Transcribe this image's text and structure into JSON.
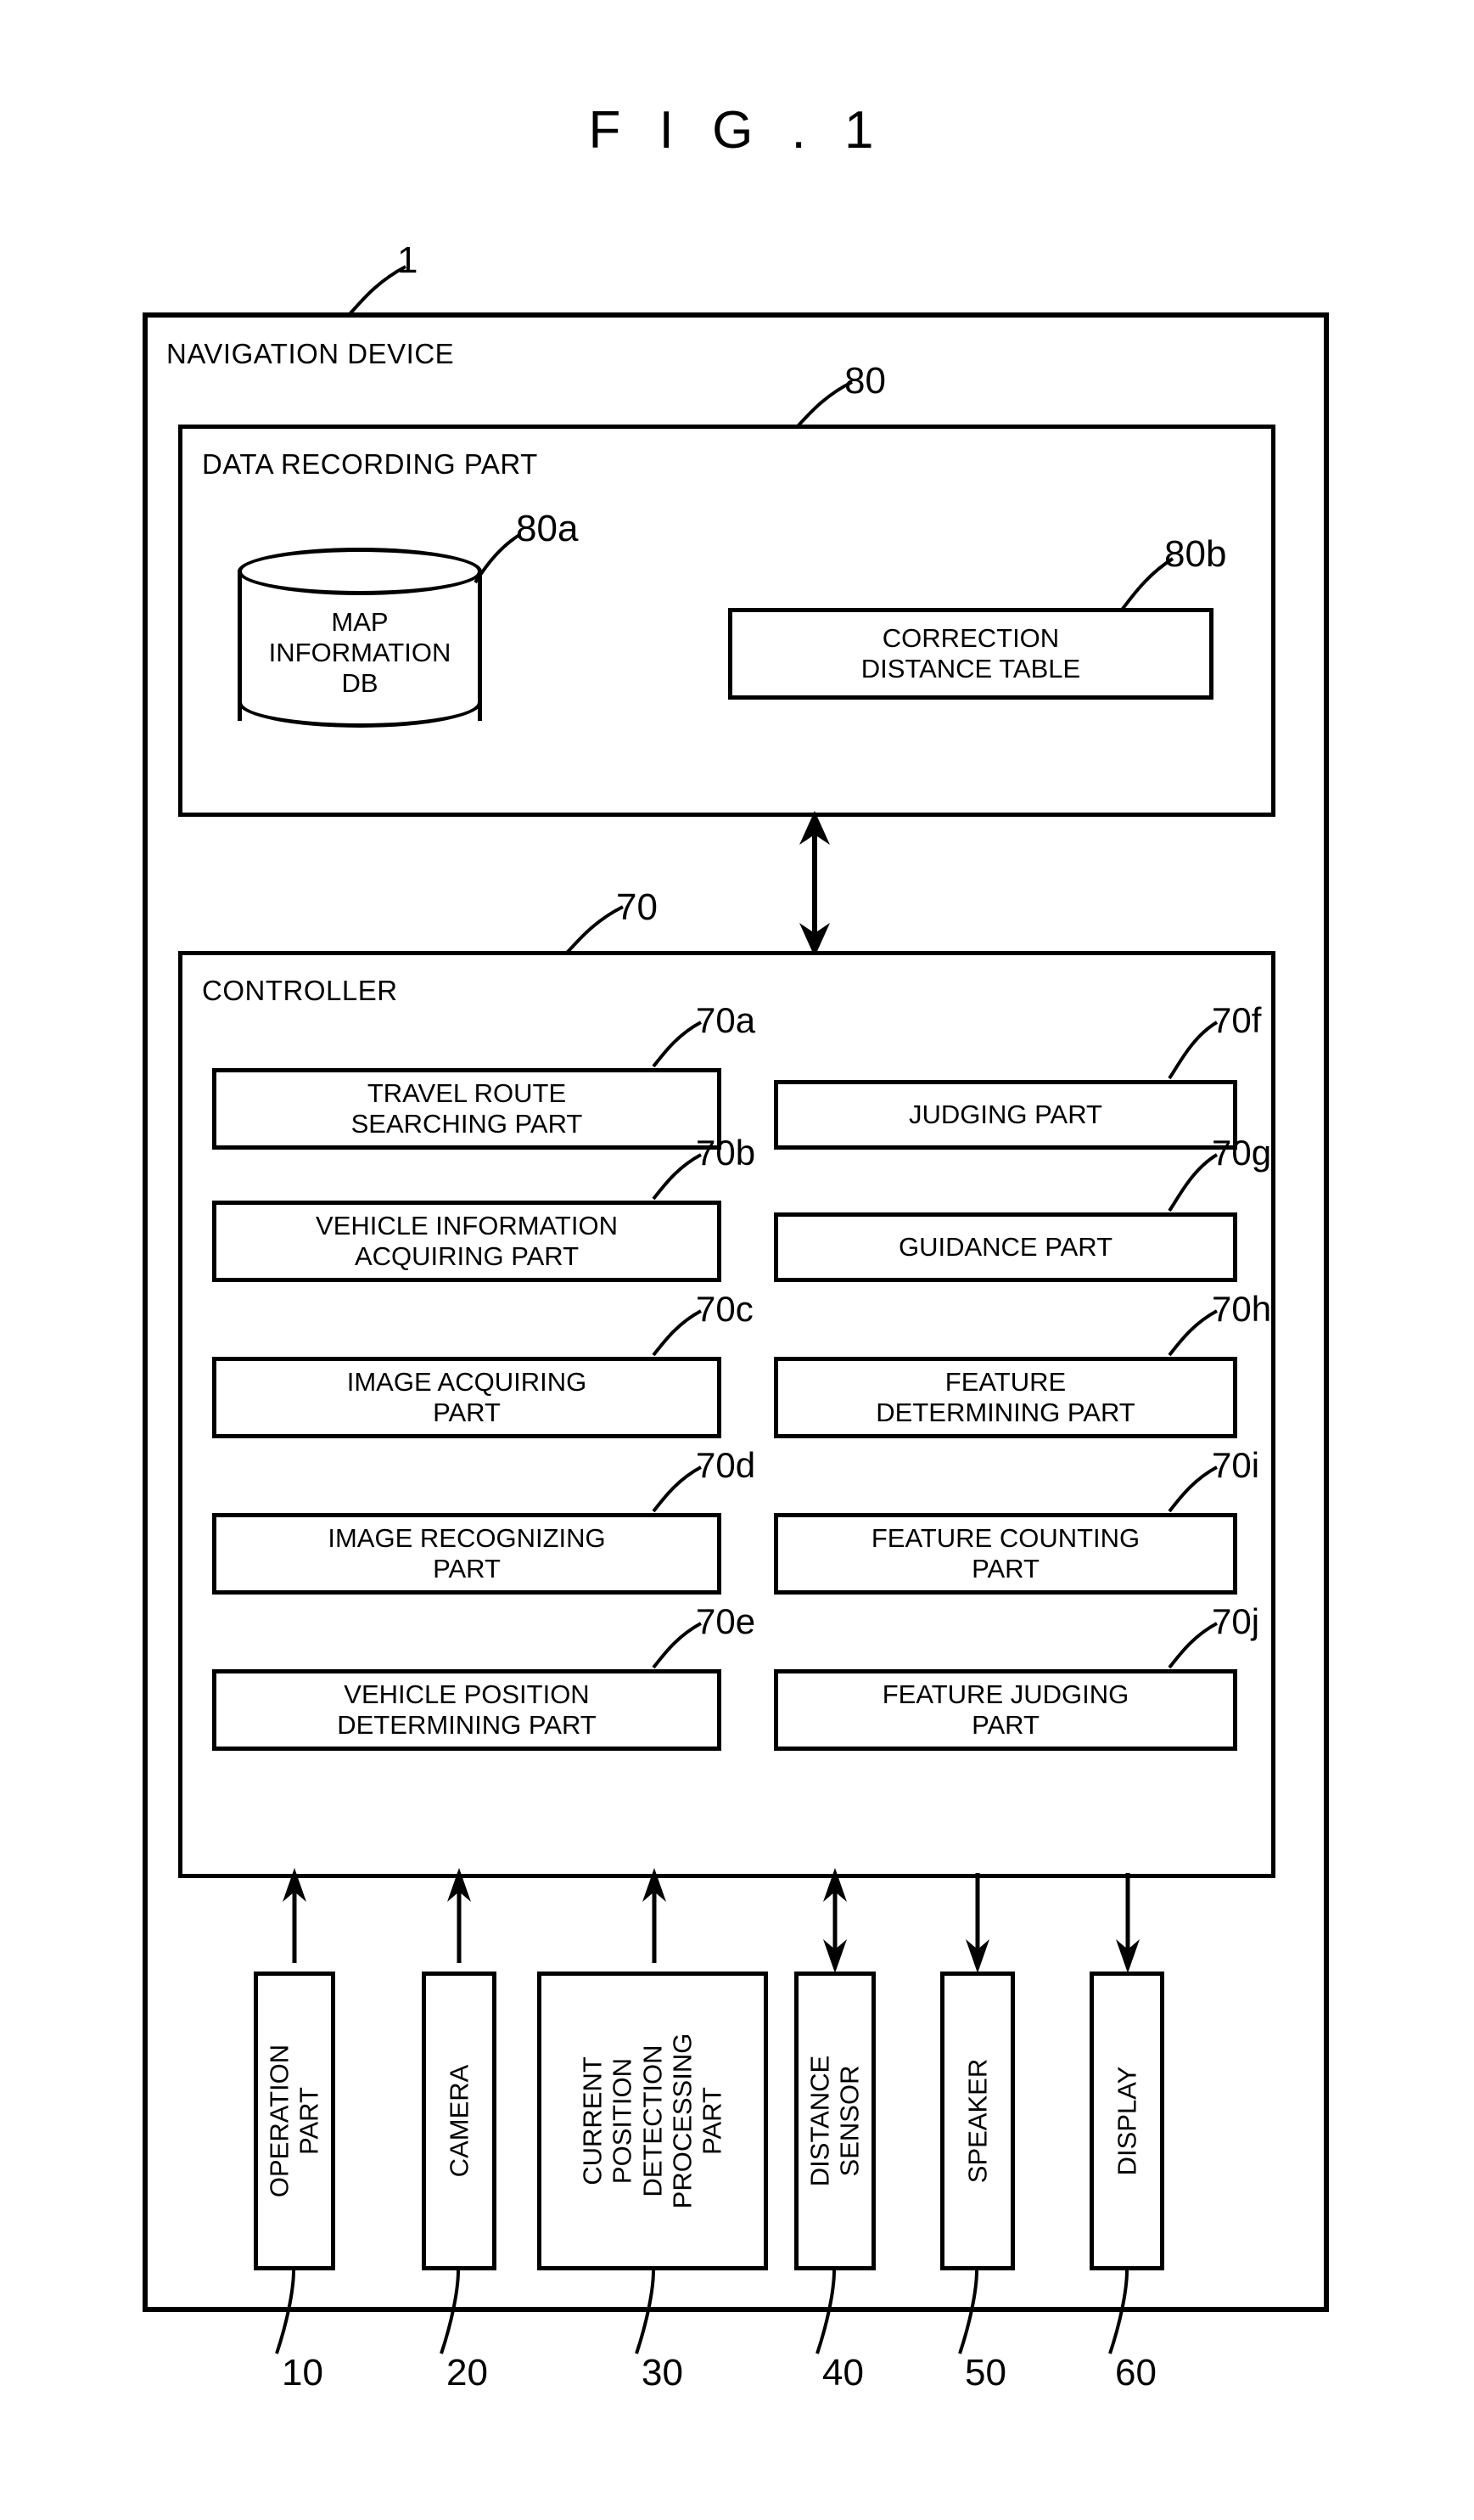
{
  "figure": {
    "title": "F I G . 1"
  },
  "navigation_device": {
    "label": "NAVIGATION DEVICE",
    "ref": "1"
  },
  "data_recording_part": {
    "label": "DATA RECORDING PART",
    "ref": "80",
    "map_db": {
      "label": "MAP\nINFORMATION\nDB",
      "ref": "80a"
    },
    "correction_distance_table": {
      "label": "CORRECTION\nDISTANCE TABLE",
      "ref": "80b"
    }
  },
  "controller": {
    "label": "CONTROLLER",
    "ref": "70",
    "parts_left": [
      {
        "label": "TRAVEL ROUTE\nSEARCHING PART",
        "ref": "70a"
      },
      {
        "label": "VEHICLE INFORMATION\nACQUIRING PART",
        "ref": "70b"
      },
      {
        "label": "IMAGE ACQUIRING\nPART",
        "ref": "70c"
      },
      {
        "label": "IMAGE RECOGNIZING\nPART",
        "ref": "70d"
      },
      {
        "label": "VEHICLE POSITION\nDETERMINING PART",
        "ref": "70e"
      }
    ],
    "parts_right": [
      {
        "label": "JUDGING PART",
        "ref": "70f"
      },
      {
        "label": "GUIDANCE PART",
        "ref": "70g"
      },
      {
        "label": "FEATURE\nDETERMINING PART",
        "ref": "70h"
      },
      {
        "label": "FEATURE COUNTING\nPART",
        "ref": "70i"
      },
      {
        "label": "FEATURE JUDGING\nPART",
        "ref": "70j"
      }
    ]
  },
  "peripherals": [
    {
      "label": "OPERATION\nPART",
      "ref": "10",
      "arrow": "up"
    },
    {
      "label": "CAMERA",
      "ref": "20",
      "arrow": "up"
    },
    {
      "label": "CURRENT\nPOSITION\nDETECTION\nPROCESSING\nPART",
      "ref": "30",
      "arrow": "up"
    },
    {
      "label": "DISTANCE\nSENSOR",
      "ref": "40",
      "arrow": "both"
    },
    {
      "label": "SPEAKER",
      "ref": "50",
      "arrow": "down"
    },
    {
      "label": "DISPLAY",
      "ref": "60",
      "arrow": "down"
    }
  ],
  "connector": {
    "between_recording_and_controller": "both"
  },
  "colors": {
    "stroke": "#000000",
    "background": "#ffffff"
  }
}
